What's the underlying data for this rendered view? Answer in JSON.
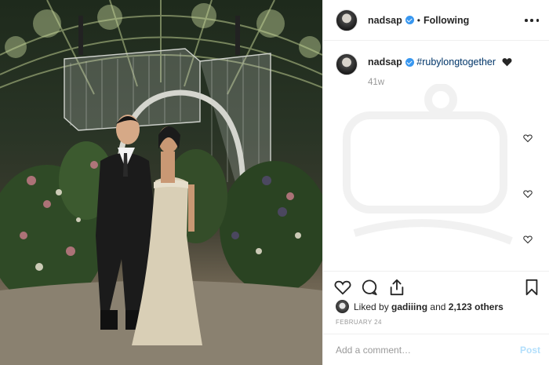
{
  "post": {
    "username": "nadsap",
    "separator": "•",
    "follow_status": "Following",
    "caption_hashtag": "#rubylongtogether",
    "time_ago": "41w",
    "liked_by_prefix": "Liked by",
    "liked_by_user": "gadiiing",
    "liked_by_conjunction": "and",
    "others_count": "2,123 others",
    "date": "FEBRUARY 24"
  },
  "comment_box": {
    "placeholder": "Add a comment…",
    "post_label": "Post"
  },
  "icons": {
    "more": "more-options-icon",
    "verified": "verified-badge-icon",
    "heart_emoji": "black-heart-emoji-icon",
    "like": "heart-outline-icon",
    "comment": "comment-bubble-icon",
    "share": "share-icon",
    "save": "bookmark-icon"
  },
  "colors": {
    "hashtag": "#003569",
    "verified": "#3897f0",
    "muted": "#999999",
    "post_disabled": "#b2dffc"
  }
}
